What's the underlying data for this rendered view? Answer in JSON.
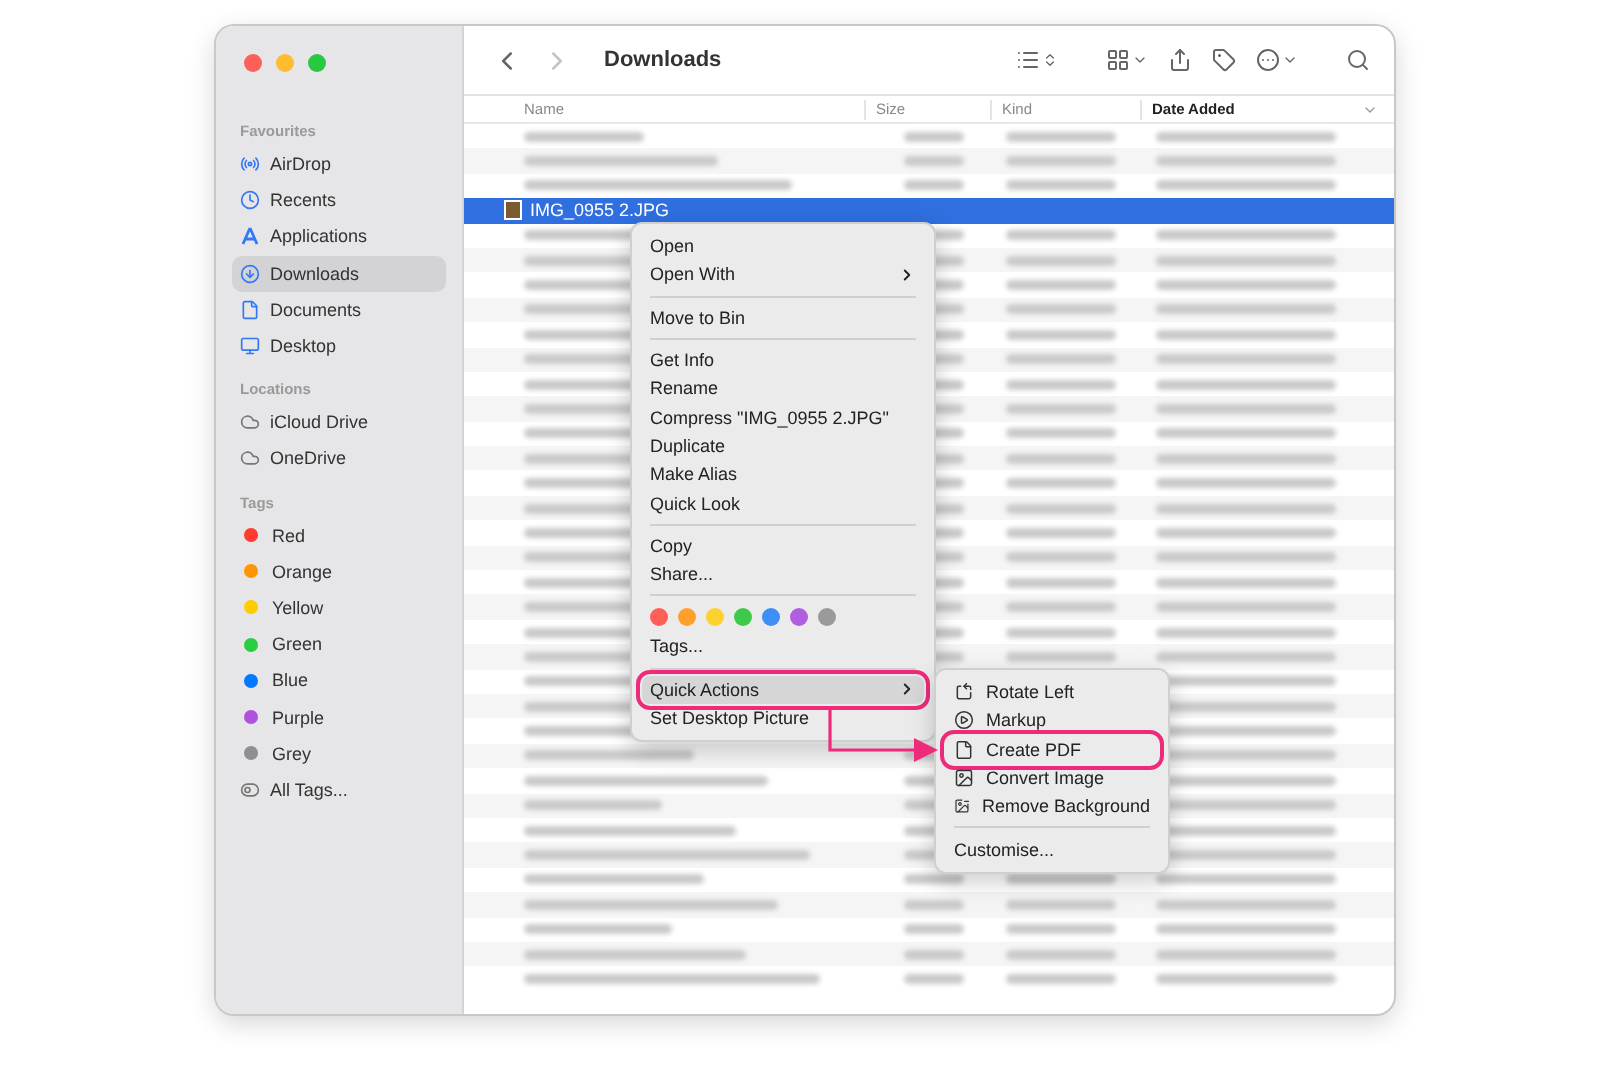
{
  "window": {
    "title": "Downloads",
    "controls": [
      {
        "color": "#fe5f57"
      },
      {
        "color": "#febc2e"
      },
      {
        "color": "#28c840"
      }
    ]
  },
  "toolbar": {
    "nav": [
      {
        "kind": "back",
        "disabled": false
      },
      {
        "kind": "forward",
        "disabled": true
      }
    ]
  },
  "sidebar": {
    "sections": [
      {
        "heading": "Favourites",
        "items": [
          {
            "label": "AirDrop",
            "kind": "airdrop",
            "selected": false
          },
          {
            "label": "Recents",
            "kind": "recents",
            "selected": false
          },
          {
            "label": "Applications",
            "kind": "applications",
            "selected": false
          },
          {
            "label": "Downloads",
            "kind": "downloads",
            "selected": true
          },
          {
            "label": "Documents",
            "kind": "documents",
            "selected": false
          },
          {
            "label": "Desktop",
            "kind": "desktop",
            "selected": false
          }
        ]
      },
      {
        "heading": "Locations",
        "items": [
          {
            "label": "iCloud Drive",
            "kind": "cloud",
            "selected": false
          },
          {
            "label": "OneDrive",
            "kind": "cloud",
            "selected": false
          }
        ]
      },
      {
        "heading": "Tags",
        "items": [
          {
            "label": "Red",
            "kind": "tag",
            "color": "#ff3b30",
            "selected": false
          },
          {
            "label": "Orange",
            "kind": "tag",
            "color": "#ff9500",
            "selected": false
          },
          {
            "label": "Yellow",
            "kind": "tag",
            "color": "#ffcc00",
            "selected": false
          },
          {
            "label": "Green",
            "kind": "tag",
            "color": "#28cd41",
            "selected": false
          },
          {
            "label": "Blue",
            "kind": "tag",
            "color": "#007aff",
            "selected": false
          },
          {
            "label": "Purple",
            "kind": "tag",
            "color": "#af52de",
            "selected": false
          },
          {
            "label": "Grey",
            "kind": "tag",
            "color": "#8e8e93",
            "selected": false
          },
          {
            "label": "All Tags...",
            "kind": "alltags",
            "selected": false
          }
        ]
      }
    ]
  },
  "table": {
    "columns": [
      {
        "label": "Name",
        "sorted": false
      },
      {
        "label": "Size",
        "sorted": false
      },
      {
        "label": "Kind",
        "sorted": false
      },
      {
        "label": "Date Added",
        "sorted": true
      }
    ],
    "rows": [
      {
        "kind": "blurred",
        "selected": false
      },
      {
        "kind": "blurred",
        "selected": false
      },
      {
        "kind": "blurred",
        "selected": false
      },
      {
        "kind": "file",
        "name": "IMG_0955 2.JPG",
        "selected": true
      },
      {
        "kind": "blurred",
        "selected": false
      },
      {
        "kind": "blurred",
        "selected": false
      },
      {
        "kind": "blurred",
        "selected": false
      },
      {
        "kind": "blurred",
        "selected": false
      },
      {
        "kind": "blurred",
        "selected": false
      },
      {
        "kind": "blurred",
        "selected": false
      },
      {
        "kind": "blurred",
        "selected": false
      },
      {
        "kind": "blurred",
        "selected": false
      },
      {
        "kind": "blurred",
        "selected": false
      },
      {
        "kind": "blurred",
        "selected": false
      },
      {
        "kind": "blurred",
        "selected": false
      },
      {
        "kind": "blurred",
        "selected": false
      },
      {
        "kind": "blurred",
        "selected": false
      },
      {
        "kind": "blurred",
        "selected": false
      },
      {
        "kind": "blurred",
        "selected": false
      },
      {
        "kind": "blurred",
        "selected": false
      },
      {
        "kind": "blurred",
        "selected": false
      },
      {
        "kind": "blurred",
        "selected": false
      },
      {
        "kind": "blurred",
        "selected": false
      },
      {
        "kind": "blurred",
        "selected": false
      },
      {
        "kind": "blurred",
        "selected": false
      },
      {
        "kind": "blurred",
        "selected": false
      },
      {
        "kind": "blurred",
        "selected": false
      },
      {
        "kind": "blurred",
        "selected": false
      },
      {
        "kind": "blurred",
        "selected": false
      },
      {
        "kind": "blurred",
        "selected": false
      },
      {
        "kind": "blurred",
        "selected": false
      },
      {
        "kind": "blurred",
        "selected": false
      },
      {
        "kind": "blurred",
        "selected": false
      },
      {
        "kind": "blurred",
        "selected": false
      },
      {
        "kind": "blurred",
        "selected": false
      }
    ]
  },
  "context_menu": {
    "items": [
      {
        "kind": "item",
        "label": "Open",
        "has_submenu": false,
        "highlighted": false,
        "annotated": false
      },
      {
        "kind": "item",
        "label": "Open With",
        "has_submenu": true,
        "highlighted": false,
        "annotated": false
      },
      {
        "kind": "separator"
      },
      {
        "kind": "item",
        "label": "Move to Bin",
        "has_submenu": false,
        "highlighted": false,
        "annotated": false
      },
      {
        "kind": "separator"
      },
      {
        "kind": "item",
        "label": "Get Info",
        "has_submenu": false,
        "highlighted": false,
        "annotated": false
      },
      {
        "kind": "item",
        "label": "Rename",
        "has_submenu": false,
        "highlighted": false,
        "annotated": false
      },
      {
        "kind": "item",
        "label": "Compress \"IMG_0955 2.JPG\"",
        "has_submenu": false,
        "highlighted": false,
        "annotated": false
      },
      {
        "kind": "item",
        "label": "Duplicate",
        "has_submenu": false,
        "highlighted": false,
        "annotated": false
      },
      {
        "kind": "item",
        "label": "Make Alias",
        "has_submenu": false,
        "highlighted": false,
        "annotated": false
      },
      {
        "kind": "item",
        "label": "Quick Look",
        "has_submenu": false,
        "highlighted": false,
        "annotated": false
      },
      {
        "kind": "separator"
      },
      {
        "kind": "item",
        "label": "Copy",
        "has_submenu": false,
        "highlighted": false,
        "annotated": false
      },
      {
        "kind": "item",
        "label": "Share...",
        "has_submenu": false,
        "highlighted": false,
        "annotated": false
      },
      {
        "kind": "separator"
      },
      {
        "kind": "colors",
        "colors": [
          {
            "color": "#fe5f57"
          },
          {
            "color": "#ff9f2e"
          },
          {
            "color": "#fed22e"
          },
          {
            "color": "#3fc94b"
          },
          {
            "color": "#3d8ef7"
          },
          {
            "color": "#b15ee0"
          },
          {
            "color": "#9a9a9a"
          }
        ]
      },
      {
        "kind": "item",
        "label": "Tags...",
        "has_submenu": false,
        "highlighted": false,
        "annotated": false
      },
      {
        "kind": "separator"
      },
      {
        "kind": "item",
        "label": "Quick Actions",
        "has_submenu": true,
        "highlighted": true,
        "annotated": true
      },
      {
        "kind": "item",
        "label": "Set Desktop Picture",
        "has_submenu": false,
        "highlighted": false,
        "annotated": false
      }
    ]
  },
  "submenu": {
    "items": [
      {
        "kind": "rotate",
        "label": "Rotate Left",
        "annotated": false
      },
      {
        "kind": "markup",
        "label": "Markup",
        "annotated": false
      },
      {
        "kind": "pdf",
        "label": "Create PDF",
        "annotated": true
      },
      {
        "kind": "convert",
        "label": "Convert Image",
        "annotated": false
      },
      {
        "kind": "removebg",
        "label": "Remove Background",
        "annotated": false
      },
      {
        "kind": "separator"
      },
      {
        "kind": "plain",
        "label": "Customise...",
        "annotated": false
      }
    ]
  }
}
